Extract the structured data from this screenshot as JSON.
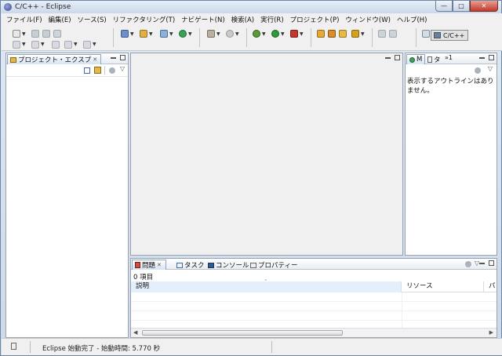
{
  "window": {
    "title": "C/C++ - Eclipse"
  },
  "menubar": {
    "items": [
      "ファイル(F)",
      "編集(E)",
      "ソース(S)",
      "リファクタリング(T)",
      "ナビゲート(N)",
      "検索(A)",
      "実行(R)",
      "プロジェクト(P)",
      "ウィンドウ(W)",
      "ヘルプ(H)"
    ]
  },
  "toolbar": {
    "perspective_label": "C/C++"
  },
  "project_explorer": {
    "tab_label": "プロジェクト・エクスプ"
  },
  "outline": {
    "tab_labels": [
      "M",
      "タ"
    ],
    "overflow_label": "»1",
    "message": "表示するアウトラインはありません。"
  },
  "bottom_panel": {
    "tabs": [
      "問題",
      "タスク",
      "コンソール",
      "プロパティー"
    ],
    "item_count": "0 項目",
    "columns": [
      "説明",
      "リソース",
      "パス"
    ]
  },
  "statusbar": {
    "text": "Eclipse 始動完了 - 始動時間: 5.770 秒"
  },
  "colors": {
    "titlebar": "#c9d8ea",
    "chrome": "#f0f0f0",
    "active_tab": "#d5e2f1",
    "selected_header": "#e3f0fb"
  }
}
